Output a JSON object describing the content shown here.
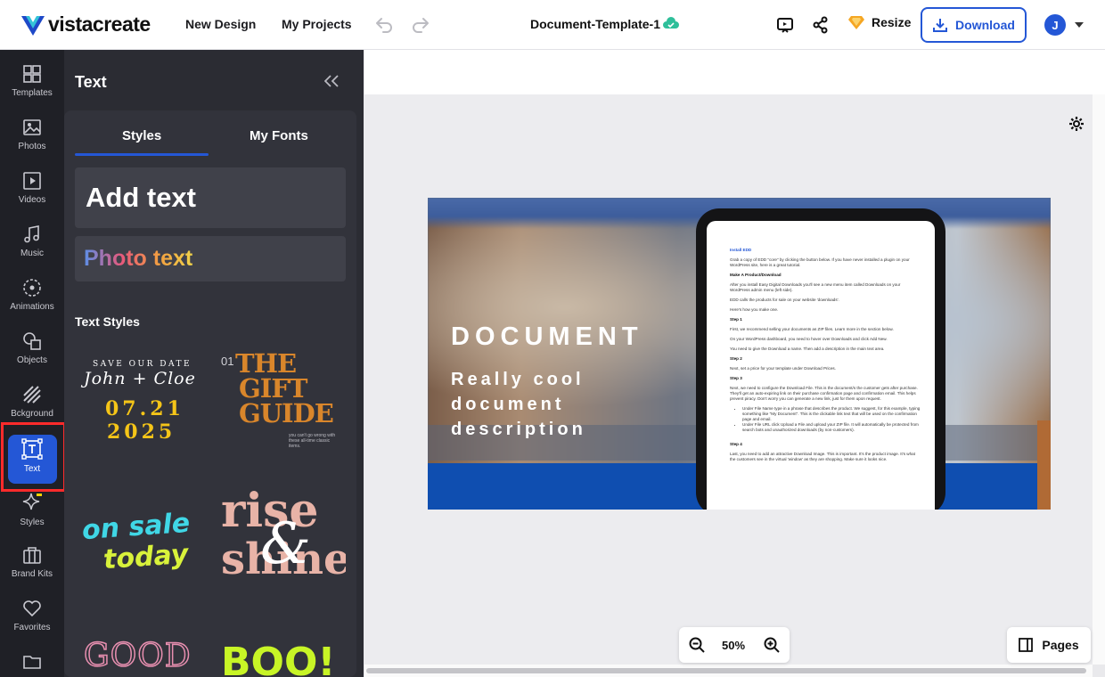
{
  "app": {
    "brand": "vistacreate"
  },
  "header": {
    "nav": [
      "New Design",
      "My Projects"
    ],
    "document_title": "Document-Template-1",
    "resize_label": "Resize",
    "download_label": "Download",
    "avatar_initial": "J"
  },
  "rail": {
    "items": [
      {
        "label": "Templates",
        "icon": "templates-icon"
      },
      {
        "label": "Photos",
        "icon": "photo-icon"
      },
      {
        "label": "Videos",
        "icon": "video-icon"
      },
      {
        "label": "Music",
        "icon": "music-icon"
      },
      {
        "label": "Animations",
        "icon": "animation-icon"
      },
      {
        "label": "Objects",
        "icon": "objects-icon"
      },
      {
        "label": "Bckground",
        "icon": "background-icon"
      },
      {
        "label": "Text",
        "icon": "text-icon",
        "active": true
      },
      {
        "label": "Styles",
        "icon": "sparkle-icon"
      },
      {
        "label": "Brand Kits",
        "icon": "briefcase-icon"
      },
      {
        "label": "Favorites",
        "icon": "heart-icon"
      },
      {
        "label": "",
        "icon": "folder-icon"
      }
    ]
  },
  "panel": {
    "title": "Text",
    "tabs": [
      "Styles",
      "My Fonts"
    ],
    "active_tab": "Styles",
    "add_text": "Add text",
    "photo_text": "Photo text",
    "section_label": "Text Styles",
    "samples": {
      "save_date": {
        "line1": "SAVE OUR DATE",
        "names": "John + Cloe",
        "date1": "07.21",
        "date2": "2025"
      },
      "gift": {
        "num": "01",
        "l1": "THE",
        "l2": "GIFT",
        "l3": "GUIDE",
        "small": "you can't go wrong with these all-time classic items."
      },
      "sale": {
        "l1": "on sale",
        "l2": "today"
      },
      "rise": {
        "l1": "rise",
        "amp": "&",
        "l2": "shine"
      },
      "good": {
        "l1": "GOOD"
      },
      "boo": {
        "l1": "BOO!"
      }
    }
  },
  "canvas": {
    "headline": "DOCUMENT",
    "subtitle": "Really cool document description",
    "zoom": "50%",
    "pages_label": "Pages",
    "tablet": {
      "heading": "Install EDD",
      "paragraphs": [
        "Grab a copy of EDD \"core\" by clicking the button below. If you have never installed a plugin on your WordPress site, here is a great tutorial.",
        "Make A Product/Download",
        "After you install Easy Digital Downloads you'll see a new menu item called Downloads on your WordPress admin menu (left side).",
        "EDD calls the products for sale on your website 'downloads'.",
        "Here's how you make one.",
        "Step 1",
        "First, we recommend selling your documents as ZIP files. Learn more in the section below.",
        "On your WordPress dashboard, you need to hover over Downloads and click Add New.",
        "You need to give the Download a name. Then add a description in the main text area.",
        "Step 2",
        "Next, set a price for your template under Download Prices.",
        "Step 3",
        "Next, we need to configure the Download File. This is the document/s the customer gets after purchase. They'll get an auto-expiring link on their purchase confirmation page and confirmation email. This helps prevent piracy. Don't worry you can generate a new link, just for them upon request."
      ],
      "bullets": [
        "Under File Name type in a phrase that describes the product. We suggest, for this example, typing something like \"My Document\". This is the clickable link text that will be used on the confirmation page and email.",
        "Under File URL click Upload a File and upload your ZIP file. It will automatically be protected from search bots and unauthorized downloads (by non-customers)."
      ],
      "step4": "Step 4",
      "step4_text": "Last, you need to add an attractive Download Image. This is important. It's the product image. It's what the customers see in the virtual 'window' as they are shopping. Make sure it looks nice."
    }
  },
  "colors": {
    "accent": "#2457d6",
    "rail_bg": "#1f2026",
    "panel_bg": "#2b2c33",
    "highlight": "#ff2b2b"
  }
}
